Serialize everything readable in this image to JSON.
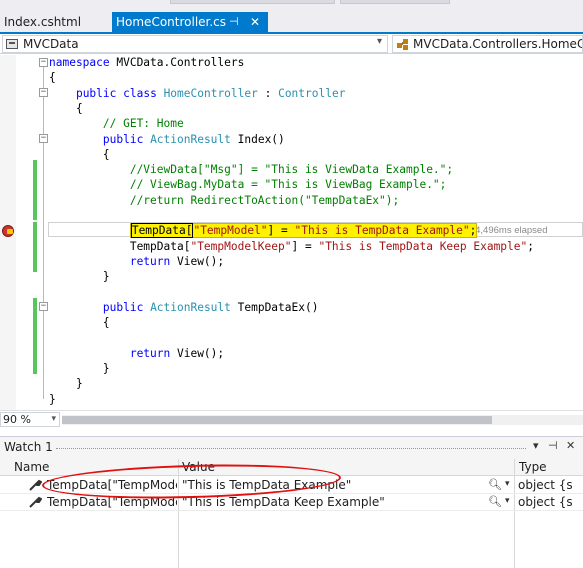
{
  "tabs": [
    {
      "label": "Index.cshtml",
      "active": false
    },
    {
      "label": "HomeController.cs",
      "active": true,
      "pin": "⊣",
      "close": "✕"
    }
  ],
  "navbar": {
    "project": "MVCData",
    "member": "MVCData.Controllers.HomeController"
  },
  "code": {
    "line1": {
      "kw": "namespace",
      "rest": " MVCData.Controllers"
    },
    "line2": "{",
    "line3": {
      "kw1": "public",
      "kw2": "class",
      "type1": "HomeController",
      "sep": " : ",
      "type2": "Controller"
    },
    "line4": "{",
    "line5": "// GET: Home",
    "line6": {
      "kw": "public",
      "type": "ActionResult",
      "rest": " Index()"
    },
    "line7": "{",
    "line8": "//ViewData[\"Msg\"] = \"This is ViewData Example.\";",
    "line9": "// ViewBag.MyData = \"This is ViewBag Example.\";",
    "line10": "//return RedirectToAction(\"TempDataEx\");",
    "line12": {
      "pre": "TempData[",
      "s1": "\"TempModel\"",
      "mid": "] = ",
      "s2": "\"This is TempData Example\"",
      "end": ";"
    },
    "line13": {
      "pre": "TempData[",
      "s1": "\"TempModelKeep\"",
      "mid": "] = ",
      "s2": "\"This is TempData Keep Example\"",
      "end": ";"
    },
    "line14": {
      "kw": "return",
      "rest": " View();"
    },
    "line15": "}",
    "line17": {
      "kw": "public",
      "type": "ActionResult",
      "rest": " TempDataEx()"
    },
    "line18": "{",
    "line20": {
      "kw": "return",
      "rest": " View();"
    },
    "line21": "}",
    "line22": "}",
    "line23": "}",
    "elapsed": "≤ 14,496ms elapsed"
  },
  "zoom": "90 %",
  "watch": {
    "title": "Watch 1",
    "buttons": {
      "dropdown": "▾",
      "pin": "⊣",
      "close": "✕"
    },
    "columns": [
      "Name",
      "Value",
      "Type"
    ],
    "rows": [
      {
        "name": "TempData[\"TempModel\"",
        "value": "\"This is TempData Example\"",
        "type": "object {s"
      },
      {
        "name": "TempData[\"TempModelK",
        "value": "\"This is TempData Keep Example\"",
        "type": "object {s"
      }
    ]
  },
  "colors": {
    "accent": "#007acc",
    "keyword": "#0000ff",
    "type": "#2b91af",
    "comment": "#008000",
    "string": "#a31515",
    "highlight": "#fff200",
    "annotation": "#e01010"
  }
}
